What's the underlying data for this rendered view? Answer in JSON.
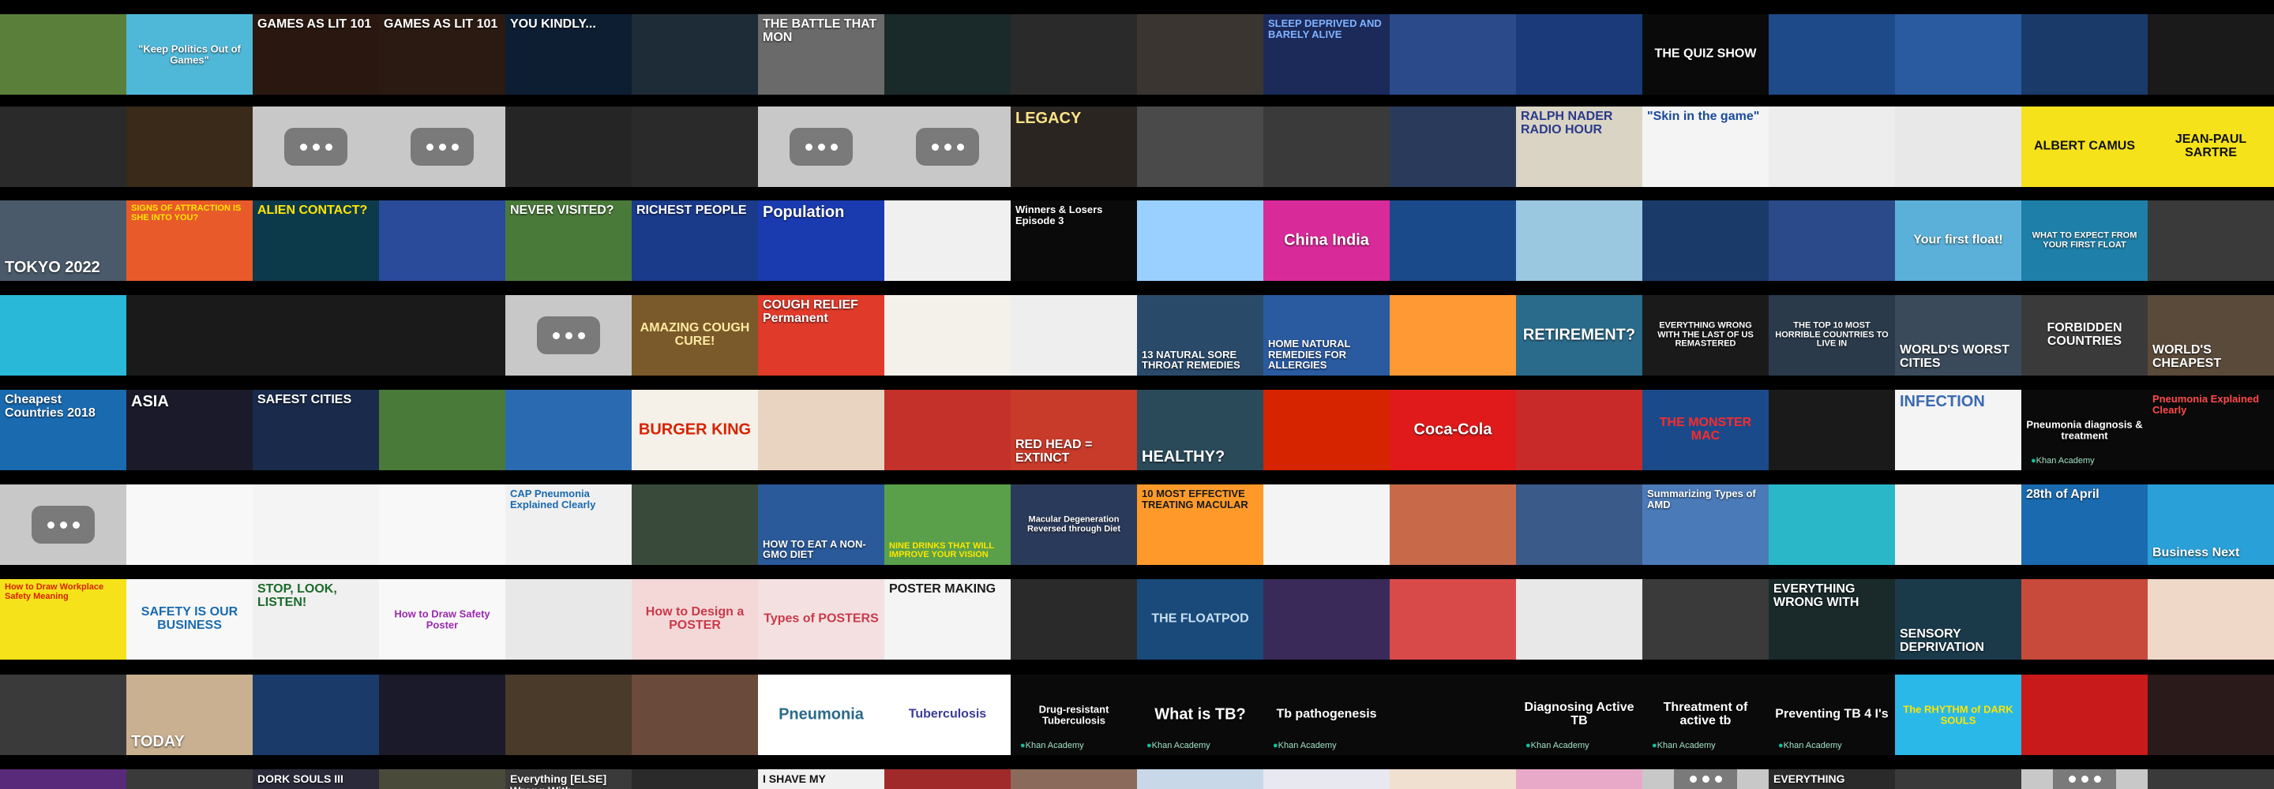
{
  "rows": [
    [
      {
        "bg": "#5a7f3a"
      },
      {
        "bg": "#4fb8d9",
        "text": "\"Keep Politics Out of Games\"",
        "color": "#ffffff",
        "pos": "center"
      },
      {
        "bg": "#2a1810",
        "text": "GAMES AS LIT 101",
        "color": "#ffffff",
        "pos": "top"
      },
      {
        "bg": "#2a1a12",
        "text": "GAMES AS LIT 101",
        "color": "#ffffff",
        "pos": "top"
      },
      {
        "bg": "#0d1e33",
        "text": "YOU KINDLY...",
        "color": "#ffffff",
        "pos": "top"
      },
      {
        "bg": "#1e2c38"
      },
      {
        "bg": "#6a6a6a",
        "text": "THE BATTLE THAT MON",
        "color": "#ffffff",
        "pos": "top"
      },
      {
        "bg": "#1a2a2a"
      },
      {
        "bg": "#2a2a2a"
      },
      {
        "bg": "#3a3530"
      },
      {
        "bg": "#1c2a5a",
        "text": "SLEEP DEPRIVED AND BARELY ALIVE",
        "color": "#7fb3ff",
        "pos": "top"
      },
      {
        "bg": "#2a4a8a"
      },
      {
        "bg": "#1a3a7a"
      },
      {
        "bg": "#0a0a0a",
        "text": "THE QUIZ SHOW",
        "color": "#ffffff",
        "pos": "center"
      },
      {
        "bg": "#1f4a8a"
      },
      {
        "bg": "#2a5aa0"
      },
      {
        "bg": "#1a3a6a"
      },
      {
        "bg": "#1a1a1a"
      }
    ],
    [
      {
        "bg": "#2a2a2a"
      },
      {
        "bg": "#3a2a1a"
      },
      {
        "bg": "#c8c8c8",
        "ph": true
      },
      {
        "bg": "#c8c8c8",
        "ph": true
      },
      {
        "bg": "#252525"
      },
      {
        "bg": "#2a2a2a"
      },
      {
        "bg": "#c8c8c8",
        "ph": true
      },
      {
        "bg": "#c8c8c8",
        "ph": true
      },
      {
        "bg": "#2a2520",
        "text": "LEGACY",
        "color": "#ffe38a",
        "pos": "top"
      },
      {
        "bg": "#4a4a4a"
      },
      {
        "bg": "#3a3a3a"
      },
      {
        "bg": "#2a3a5a"
      },
      {
        "bg": "#d9d4c4",
        "text": "RALPH NADER RADIO HOUR",
        "color": "#2a3a8a",
        "pos": "top"
      },
      {
        "bg": "#f4f4f4",
        "text": "\"Skin in the game\"",
        "color": "#1a4a9a",
        "pos": "top"
      },
      {
        "bg": "#ededed"
      },
      {
        "bg": "#e8e8e8"
      },
      {
        "bg": "#f5e21a",
        "text": "ALBERT CAMUS",
        "color": "#111111",
        "pos": "center"
      },
      {
        "bg": "#f5e21a",
        "text": "JEAN-PAUL SARTRE",
        "color": "#111111",
        "pos": "center"
      }
    ],
    [
      {
        "bg": "#4a5a6a",
        "text": "TOKYO 2022",
        "color": "#ffffff",
        "pos": "bottom"
      },
      {
        "bg": "#e85a2a",
        "text": "SIGNS OF ATTRACTION IS SHE INTO YOU?",
        "color": "#ffe600",
        "pos": "top"
      },
      {
        "bg": "#0d3a4a",
        "text": "ALIEN CONTACT?",
        "color": "#ffe600",
        "pos": "top"
      },
      {
        "bg": "#2a4a9a"
      },
      {
        "bg": "#4a7a3a",
        "text": "NEVER VISITED?",
        "color": "#ffffff",
        "pos": "top"
      },
      {
        "bg": "#1a3a8a",
        "text": "RICHEST PEOPLE",
        "color": "#ffffff",
        "pos": "top"
      },
      {
        "bg": "#1a3ab0",
        "text": "Population",
        "color": "#ffffff",
        "pos": "top"
      },
      {
        "bg": "#f0f0f0"
      },
      {
        "bg": "#0a0a0a",
        "text": "Winners & Losers Episode 3",
        "color": "#ffffff",
        "pos": "top"
      },
      {
        "bg": "#9ad0ff"
      },
      {
        "bg": "#d92a9a",
        "text": "China India",
        "color": "#ffffff",
        "pos": "center"
      },
      {
        "bg": "#1a4a8a"
      },
      {
        "bg": "#9ac8e0"
      },
      {
        "bg": "#1a3a6a"
      },
      {
        "bg": "#2a4a8a"
      },
      {
        "bg": "#5ab0d8",
        "text": "Your first float!",
        "color": "#ffffff",
        "pos": "center"
      },
      {
        "bg": "#1e7fa8",
        "text": "WHAT TO EXPECT FROM YOUR FIRST FLOAT",
        "color": "#ffffff",
        "pos": "center"
      },
      {
        "bg": "#3a3a3a"
      }
    ],
    [
      {
        "bg": "#2ab8d8"
      },
      {
        "bg": "#1a1a1a"
      },
      {
        "bg": "#1a1a1a"
      },
      {
        "bg": "#1a1a1a"
      },
      {
        "bg": "#c8c8c8",
        "ph": true
      },
      {
        "bg": "#7a5a2a",
        "text": "AMAZING COUGH CURE!",
        "color": "#ffe9a0",
        "pos": "center"
      },
      {
        "bg": "#e03a2a",
        "text": "COUGH RELIEF Permanent",
        "color": "#ffffff",
        "pos": "top"
      },
      {
        "bg": "#f4f0ea"
      },
      {
        "bg": "#eeeeee"
      },
      {
        "bg": "#2a4a6a",
        "text": "13 NATURAL SORE THROAT REMEDIES",
        "color": "#ffffff",
        "pos": "bottom"
      },
      {
        "bg": "#2a5aa0",
        "text": "HOME NATURAL REMEDIES FOR ALLERGIES",
        "color": "#ffffff",
        "pos": "bottom"
      },
      {
        "bg": "#ff9933"
      },
      {
        "bg": "#2a6a8a",
        "text": "RETIREMENT?",
        "color": "#ffffff",
        "pos": "center"
      },
      {
        "bg": "#1a1a1a",
        "text": "EVERYTHING WRONG WITH THE LAST OF US REMASTERED",
        "color": "#ffffff",
        "pos": "center"
      },
      {
        "bg": "#2a3a4a",
        "text": "THE TOP 10 MOST HORRIBLE COUNTRIES TO LIVE IN",
        "color": "#ffffff",
        "pos": "center"
      },
      {
        "bg": "#3a4a5a",
        "text": "WORLD'S WORST CITIES",
        "color": "#ffffff",
        "pos": "bottom"
      },
      {
        "bg": "#3a3a3a",
        "text": "FORBIDDEN COUNTRIES",
        "color": "#ffffff",
        "pos": "center"
      },
      {
        "bg": "#5a4a3a",
        "text": "WORLD'S CHEAPEST",
        "color": "#ffffff",
        "pos": "bottom"
      }
    ],
    [
      {
        "bg": "#1a6ab0",
        "text": "Cheapest Countries 2018",
        "color": "#ffffff",
        "pos": "top"
      },
      {
        "bg": "#1a1a2a",
        "text": "ASIA",
        "color": "#ffffff",
        "pos": "top"
      },
      {
        "bg": "#1a2a4a",
        "text": "SAFEST CITIES",
        "color": "#ffffff",
        "pos": "top"
      },
      {
        "bg": "#4a7a3a"
      },
      {
        "bg": "#2a6ab0"
      },
      {
        "bg": "#f5f0e8",
        "text": "BURGER KING",
        "color": "#d62300",
        "pos": "center"
      },
      {
        "bg": "#e8d4c0"
      },
      {
        "bg": "#c4302a"
      },
      {
        "bg": "#c83a2a",
        "text": "RED HEAD = EXTINCT",
        "color": "#ffffff",
        "pos": "bottom"
      },
      {
        "bg": "#2a4a5a",
        "text": "HEALTHY?",
        "color": "#ffffff",
        "pos": "bottom"
      },
      {
        "bg": "#d62300"
      },
      {
        "bg": "#e01a1a",
        "text": "Coca-Cola",
        "color": "#ffffff",
        "pos": "center"
      },
      {
        "bg": "#c82a2a"
      },
      {
        "bg": "#1a4a8a",
        "text": "THE MONSTER MAC",
        "color": "#ff2a2a",
        "pos": "center"
      },
      {
        "bg": "#1a1a1a"
      },
      {
        "bg": "#f4f4f4",
        "text": "INFECTION",
        "color": "#3a6ab0",
        "pos": "top"
      },
      {
        "bg": "#0a0a0a",
        "text": "Pneumonia diagnosis & treatment",
        "color": "#ffffff",
        "pos": "center",
        "ka": "Khan Academy"
      },
      {
        "bg": "#0a0a0a",
        "text": "Pneumonia Explained Clearly",
        "color": "#ff4a4a",
        "pos": "top"
      }
    ],
    [
      {
        "bg": "#c8c8c8",
        "ph": true
      },
      {
        "bg": "#f8f8f8"
      },
      {
        "bg": "#f4f4f4"
      },
      {
        "bg": "#f8f8f8"
      },
      {
        "bg": "#f0f0f0",
        "text": "CAP Pneumonia Explained Clearly",
        "color": "#1a6ab0",
        "pos": "top"
      },
      {
        "bg": "#3a4a3a"
      },
      {
        "bg": "#2a5a9a",
        "text": "HOW TO EAT A NON-GMO DIET",
        "color": "#ffffff",
        "pos": "bottom"
      },
      {
        "bg": "#5aa04a",
        "text": "NINE DRINKS THAT WILL IMPROVE YOUR VISION",
        "color": "#ffe600",
        "pos": "bottom"
      },
      {
        "bg": "#2a3a5a",
        "text": "Macular Degeneration Reversed through Diet",
        "color": "#ffffff",
        "pos": "center"
      },
      {
        "bg": "#ff9a2a",
        "text": "10 MOST EFFECTIVE TREATING MACULAR",
        "color": "#1a1a1a",
        "pos": "top"
      },
      {
        "bg": "#f4f4f4"
      },
      {
        "bg": "#c86a4a"
      },
      {
        "bg": "#3a5a8a"
      },
      {
        "bg": "#4a7ab8",
        "text": "Summarizing Types of AMD",
        "color": "#ffffff",
        "pos": "top"
      },
      {
        "bg": "#2ab8c8"
      },
      {
        "bg": "#f0f0f0"
      },
      {
        "bg": "#1a6ab0",
        "text": "28th of April",
        "color": "#ffffff",
        "pos": "top"
      },
      {
        "bg": "#2aa0d8",
        "text": "Business Next",
        "color": "#ffffff",
        "pos": "bottom"
      }
    ],
    [
      {
        "bg": "#f5e21a",
        "text": "How to Draw Workplace Safety Meaning",
        "color": "#d62300",
        "pos": "top"
      },
      {
        "bg": "#f8f8f8",
        "text": "SAFETY IS OUR BUSINESS",
        "color": "#1a6ab0",
        "pos": "center"
      },
      {
        "bg": "#f0f0f0",
        "text": "STOP, LOOK, LISTEN!",
        "color": "#1a6a2a",
        "pos": "top"
      },
      {
        "bg": "#f8f8f8",
        "text": "How to Draw Safety Poster",
        "color": "#9a2ab0",
        "pos": "center"
      },
      {
        "bg": "#e8e8e8"
      },
      {
        "bg": "#f4d8d8",
        "text": "How to Design a POSTER",
        "color": "#c83a4a",
        "pos": "center"
      },
      {
        "bg": "#f4e0e0",
        "text": "Types of POSTERS",
        "color": "#c83a4a",
        "pos": "center"
      },
      {
        "bg": "#f4f4f4",
        "text": "POSTER MAKING",
        "color": "#1a1a1a",
        "pos": "top"
      },
      {
        "bg": "#2a2a2a"
      },
      {
        "bg": "#1a4a7a",
        "text": "THE FLOATPOD",
        "color": "#c8e0f0",
        "pos": "center"
      },
      {
        "bg": "#3a2a5a"
      },
      {
        "bg": "#d84a4a"
      },
      {
        "bg": "#e8e8e8"
      },
      {
        "bg": "#3a3a3a"
      },
      {
        "bg": "#1a2a2a",
        "text": "EVERYTHING WRONG WITH",
        "color": "#ffffff",
        "pos": "top"
      },
      {
        "bg": "#1a3a4a",
        "text": "SENSORY DEPRIVATION",
        "color": "#ffffff",
        "pos": "bottom"
      },
      {
        "bg": "#c84a3a"
      },
      {
        "bg": "#f0d8c8"
      }
    ],
    [
      {
        "bg": "#3a3a3a"
      },
      {
        "bg": "#c8b090",
        "text": "TODAY",
        "color": "#ffffff",
        "pos": "bottom"
      },
      {
        "bg": "#1a3a6a"
      },
      {
        "bg": "#1a1a2a"
      },
      {
        "bg": "#4a3a2a"
      },
      {
        "bg": "#6a4a3a"
      },
      {
        "bg": "#ffffff",
        "text": "Pneumonia",
        "color": "#2a6a8a",
        "pos": "center"
      },
      {
        "bg": "#ffffff",
        "text": "Tuberculosis",
        "color": "#3a3a9a",
        "pos": "center"
      },
      {
        "bg": "#0a0a0a",
        "text": "Drug-resistant Tuberculosis",
        "color": "#ffffff",
        "pos": "center",
        "ka": "Khan Academy"
      },
      {
        "bg": "#0a0a0a",
        "text": "What is TB?",
        "color": "#ffffff",
        "pos": "center",
        "ka": "Khan Academy"
      },
      {
        "bg": "#0a0a0a",
        "text": "Tb pathogenesis",
        "color": "#ffffff",
        "pos": "center",
        "ka": "Khan Academy"
      },
      {
        "bg": "#0a0a0a"
      },
      {
        "bg": "#0a0a0a",
        "text": "Diagnosing Active TB",
        "color": "#ffffff",
        "pos": "center",
        "ka": "Khan Academy"
      },
      {
        "bg": "#0a0a0a",
        "text": "Threatment of active tb",
        "color": "#ffffff",
        "pos": "center",
        "ka": "Khan Academy"
      },
      {
        "bg": "#0a0a0a",
        "text": "Preventing TB 4 I's",
        "color": "#ffffff",
        "pos": "center",
        "ka": "Khan Academy"
      },
      {
        "bg": "#2ab8e8",
        "text": "The RHYTHM of DARK SOULS",
        "color": "#ffe600",
        "pos": "center"
      },
      {
        "bg": "#c81a1a"
      },
      {
        "bg": "#2a1a1a"
      }
    ],
    [
      {
        "bg": "#5a2a7a"
      },
      {
        "bg": "#3a3a3a"
      },
      {
        "bg": "#2a2a3a",
        "text": "DORK SOULS III",
        "color": "#ffffff",
        "pos": "top"
      },
      {
        "bg": "#4a4a3a"
      },
      {
        "bg": "#3a3a3a",
        "text": "Everything [ELSE] Wrong With",
        "color": "#ffffff",
        "pos": "top"
      },
      {
        "bg": "#2a2a2a"
      },
      {
        "bg": "#f0f0f0",
        "text": "I SHAVE MY",
        "color": "#111111",
        "pos": "top"
      },
      {
        "bg": "#a02a2a"
      },
      {
        "bg": "#8a6a5a"
      },
      {
        "bg": "#c8d8e8"
      },
      {
        "bg": "#e8e8f0"
      },
      {
        "bg": "#f0e0d0"
      },
      {
        "bg": "#e8a8c8"
      },
      {
        "bg": "#c8c8c8",
        "ph": true
      },
      {
        "bg": "#2a2a2a",
        "text": "EVERYTHING",
        "color": "#ffffff",
        "pos": "top"
      },
      {
        "bg": "#3a3a3a"
      },
      {
        "bg": "#c8c8c8",
        "ph": true
      },
      {
        "bg": "#3a3a3a"
      }
    ]
  ]
}
